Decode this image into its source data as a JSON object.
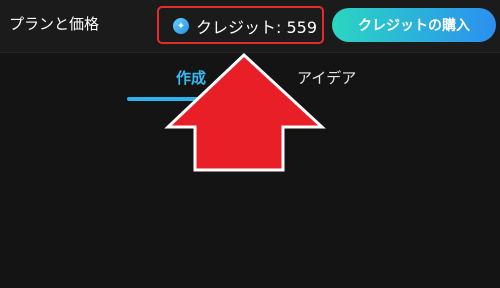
{
  "header": {
    "plans_label": "プランと価格",
    "credit_label": "クレジット: 559",
    "buy_label": "クレジットの購入",
    "credit_icon": "sparkle-icon"
  },
  "tabs": [
    {
      "label": "作成",
      "active": true
    },
    {
      "label": "アイデア",
      "active": false
    }
  ],
  "colors": {
    "background": "#141414",
    "accent_blue": "#36b9f2",
    "highlight_red": "#e32d2d",
    "button_gradient": [
      "#2bd6c2",
      "#2b8ff0"
    ]
  }
}
